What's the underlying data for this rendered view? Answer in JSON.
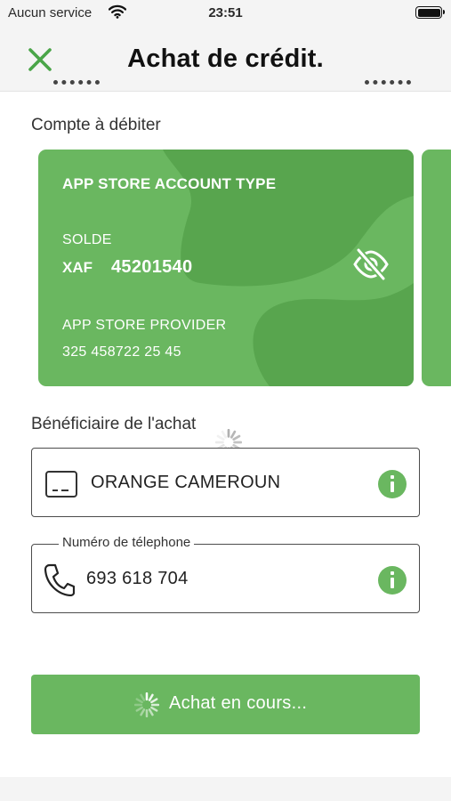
{
  "status_bar": {
    "carrier": "Aucun service",
    "time": "23:51",
    "icons": [
      "wifi-icon",
      "battery-icon"
    ]
  },
  "header": {
    "title": "Achat de crédit.",
    "close_icon": "close-icon"
  },
  "debit_section": {
    "label": "Compte à débiter",
    "card": {
      "type": "APP STORE ACCOUNT TYPE",
      "balance_label": "SOLDE",
      "currency": "XAF",
      "amount": "45201540",
      "provider": "APP STORE PROVIDER",
      "account_number": "325 458722 25 45",
      "toggle_icon": "eye-off-icon"
    }
  },
  "beneficiary_section": {
    "label": "Bénéficiaire de l'achat",
    "operator_field": {
      "value": "ORANGE CAMEROUN",
      "icon": "sim-card-icon",
      "info_icon": "info-icon"
    },
    "phone_field": {
      "legend": "Numéro de télephone",
      "value": "693 618 704",
      "icon": "phone-icon",
      "info_icon": "info-icon"
    }
  },
  "submit_button": {
    "label": "Achat en cours...",
    "icon": "spinner-icon"
  },
  "colors": {
    "accent": "#6ab760",
    "accent_dark": "#58a54e",
    "header_bg": "#f4f4f4",
    "text": "#2a2a2a"
  }
}
